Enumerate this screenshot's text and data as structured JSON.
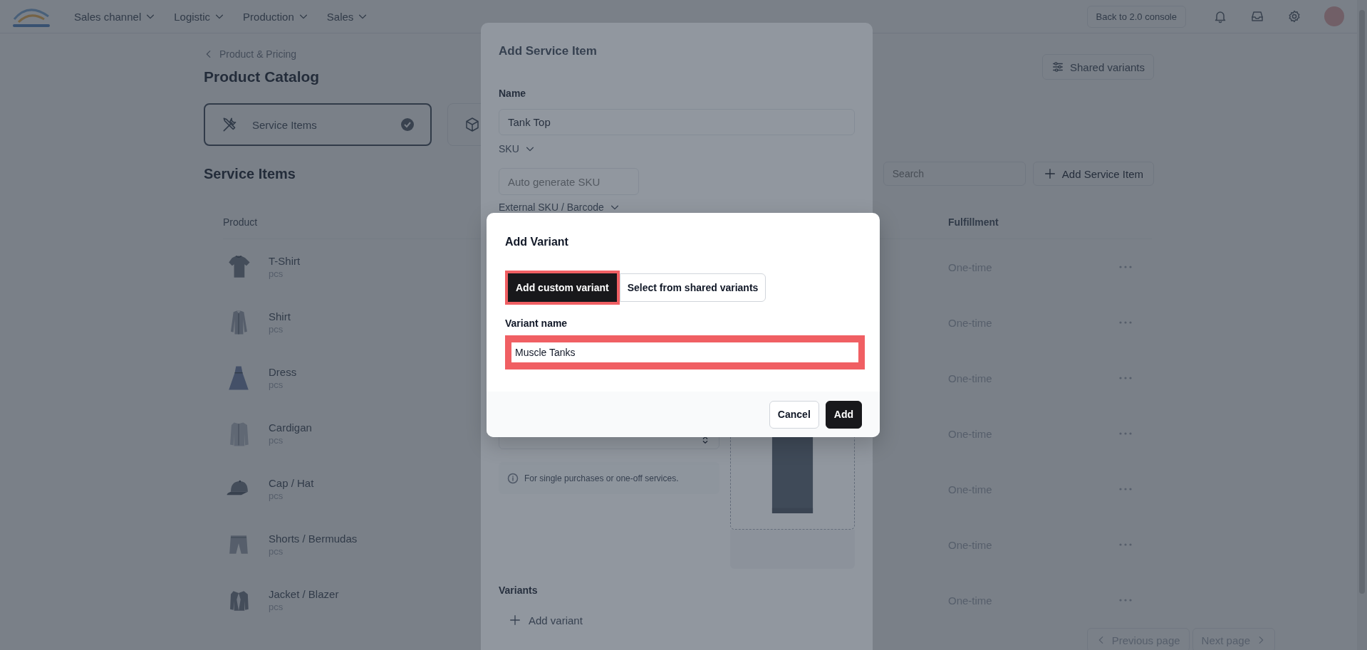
{
  "top_bar": {
    "menus": [
      {
        "label": "Sales channel"
      },
      {
        "label": "Logistic"
      },
      {
        "label": "Production"
      },
      {
        "label": "Sales"
      }
    ],
    "console_button": "Back to 2.0 console"
  },
  "catalog": {
    "breadcrumb": "Product & Pricing",
    "title": "Product Catalog",
    "shared_variants_button": "Shared variants",
    "catalog_tabs": [
      {
        "label": "Service Items",
        "selected": true
      },
      {
        "selected": false
      }
    ],
    "section_title": "Service Items",
    "search": {
      "placeholder": "Search"
    },
    "add_button": "Add Service Item",
    "table": {
      "columns": [
        "Product",
        "Fulfillment"
      ],
      "rows": [
        {
          "name": "T-Shirt",
          "unit": "pcs",
          "fulfillment": "One-time",
          "kind": "picture"
        },
        {
          "name": "Shirt",
          "unit": "pcs",
          "fulfillment": "One-time",
          "kind": "picture"
        },
        {
          "name": "Dress",
          "unit": "pcs",
          "fulfillment": "One-time",
          "kind": "picture"
        },
        {
          "name": "Cardigan",
          "unit": "pcs",
          "fulfillment": "One-time",
          "kind": "picture"
        },
        {
          "name": "Cap / Hat",
          "unit": "pcs",
          "fulfillment": "One-time",
          "kind": "picture"
        },
        {
          "name": "Shorts / Bermudas",
          "unit": "pcs",
          "fulfillment": "One-time",
          "kind": "picture"
        },
        {
          "name": "Jacket / Blazer",
          "unit": "pcs",
          "fulfillment": "One-time",
          "kind": "picture"
        }
      ]
    },
    "pagination": {
      "previous": "Previous page",
      "next": "Next page"
    }
  },
  "service_panel": {
    "title": "Add Service Item",
    "name_label": "Name",
    "name_value": "Tank Top",
    "sku_label": "SKU",
    "sku_placeholder": "Auto generate SKU",
    "external_sku_label": "External SKU / Barcode",
    "fulfillment_hint": "For single purchases or one-off services.",
    "variants_label": "Variants",
    "add_variant": "Add variant"
  },
  "dialog": {
    "title": "Add Variant",
    "modes": [
      {
        "label": "Add custom variant",
        "selected": true,
        "highlighted": true
      },
      {
        "label": "Select from shared variants",
        "selected": false,
        "highlighted": false
      }
    ],
    "field_label": "Variant name",
    "field_value": "Muscle Tanks",
    "field_highlighted": true,
    "buttons": [
      {
        "label": "Cancel",
        "kind": "secondary"
      },
      {
        "label": "Add",
        "kind": "primary"
      }
    ]
  }
}
